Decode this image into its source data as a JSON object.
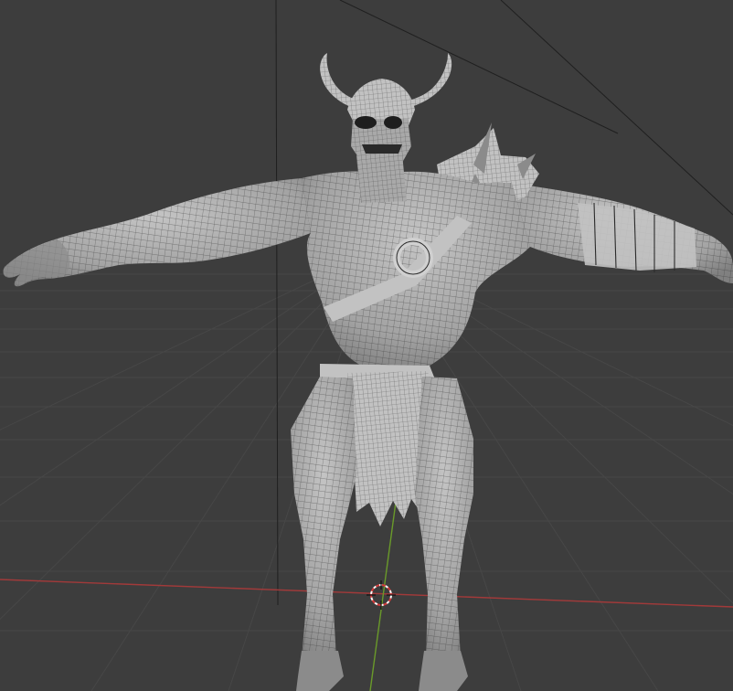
{
  "viewport": {
    "mode": "3D Viewport",
    "background": "#3d3d3d",
    "grid_color": "#474747",
    "x_axis_color": "#a23a3a",
    "y_axis_color": "#6a9a2a",
    "object": "character-mesh",
    "overlay": "wireframe",
    "cursor": "3d-cursor-icon"
  }
}
